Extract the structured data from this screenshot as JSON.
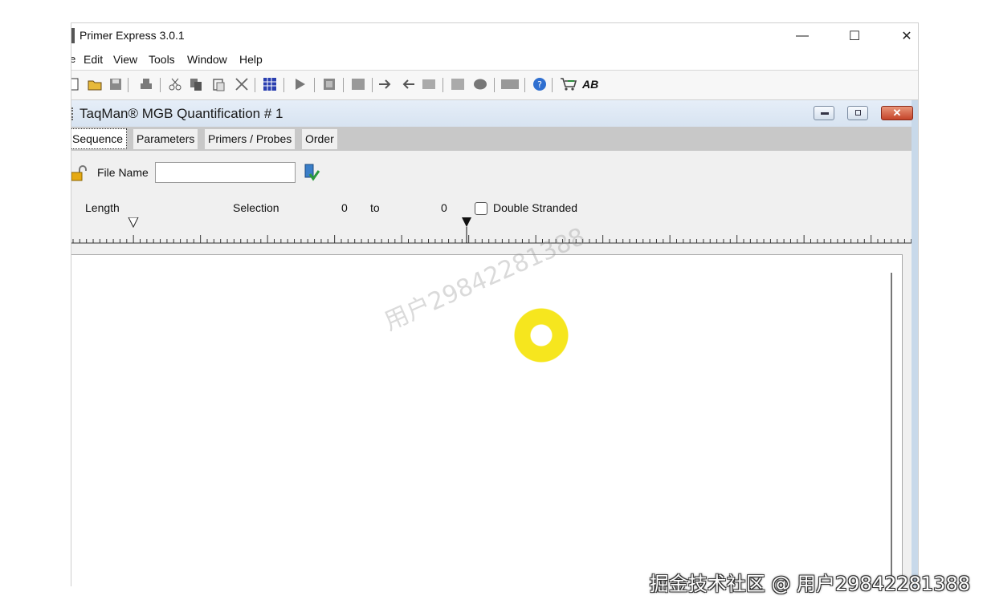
{
  "window": {
    "title": "Primer Express 3.0.1",
    "minimize": "—",
    "maximize": "☐",
    "close": "✕"
  },
  "menu": {
    "truncated_first": "e",
    "items": [
      "Edit",
      "View",
      "Tools",
      "Window",
      "Help"
    ]
  },
  "toolbar": {
    "icons": [
      "new-document-icon",
      "open-folder-icon",
      "save-icon",
      "print-icon",
      "cut-icon",
      "copy-icon",
      "paste-icon",
      "delete-icon",
      "grid-icon",
      "play-icon",
      "doc-icon",
      "sequence-icon",
      "arrow-right-icon",
      "arrow-left-icon",
      "rt-icon",
      "j-icon",
      "brain-icon",
      "orf-icon",
      "help-icon",
      "cart-icon",
      "ab-icon"
    ],
    "ab_label": "AB"
  },
  "child": {
    "title": "TaqMan® MGB Quantification # 1",
    "close_glyph": "✕"
  },
  "tabs": [
    "Sequence",
    "Parameters",
    "Primers / Probes",
    "Order"
  ],
  "form": {
    "file_name_label": "File Name",
    "file_name_value": "",
    "length_label": "Length",
    "selection_label": "Selection",
    "sel_from": "0",
    "to_label": "to",
    "sel_to": "0",
    "double_stranded_label": "Double Stranded",
    "double_stranded_checked": false
  },
  "colors": {
    "click_indicator": "#f6e61e",
    "child_title": "#dce6f2",
    "close_button": "#c84a30"
  },
  "overlay": {
    "watermark": "用户2984228​1388",
    "credit": "掘金技术社区 @ 用户29842281388"
  }
}
